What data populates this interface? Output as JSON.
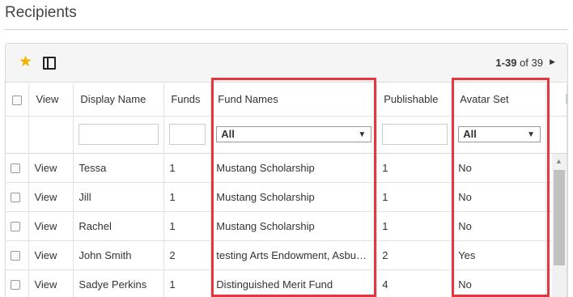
{
  "page": {
    "title": "Recipients"
  },
  "toolbar": {
    "favorite_icon": "star-icon",
    "columns_icon": "columns-panel-icon",
    "pager_range": "1-39",
    "pager_of": "of 39",
    "pager_next_icon": "triangle-right-icon"
  },
  "table": {
    "headers": {
      "view": "View",
      "display_name": "Display Name",
      "funds": "Funds",
      "fund_names": "Fund Names",
      "publishable": "Publishable",
      "avatar_set": "Avatar Set"
    },
    "filters": {
      "fund_names_selected": "All",
      "avatar_set_selected": "All"
    },
    "rows": [
      {
        "view": "View",
        "display_name": "Tessa",
        "funds": "1",
        "fund_names": "Mustang Scholarship",
        "publishable": "1",
        "avatar_set": "No"
      },
      {
        "view": "View",
        "display_name": "Jill",
        "funds": "1",
        "fund_names": "Mustang Scholarship",
        "publishable": "1",
        "avatar_set": "No"
      },
      {
        "view": "View",
        "display_name": "Rachel",
        "funds": "1",
        "fund_names": "Mustang Scholarship",
        "publishable": "1",
        "avatar_set": "No"
      },
      {
        "view": "View",
        "display_name": "John Smith",
        "funds": "2",
        "fund_names": "testing Arts Endowment, Asbu…",
        "publishable": "2",
        "avatar_set": "Yes"
      },
      {
        "view": "View",
        "display_name": "Sadye Perkins",
        "funds": "1",
        "fund_names": "Distinguished Merit Fund",
        "publishable": "4",
        "avatar_set": "No"
      }
    ]
  },
  "colors": {
    "highlight": "#e5353e",
    "link": "#2a6da3",
    "star": "#f0b400"
  }
}
